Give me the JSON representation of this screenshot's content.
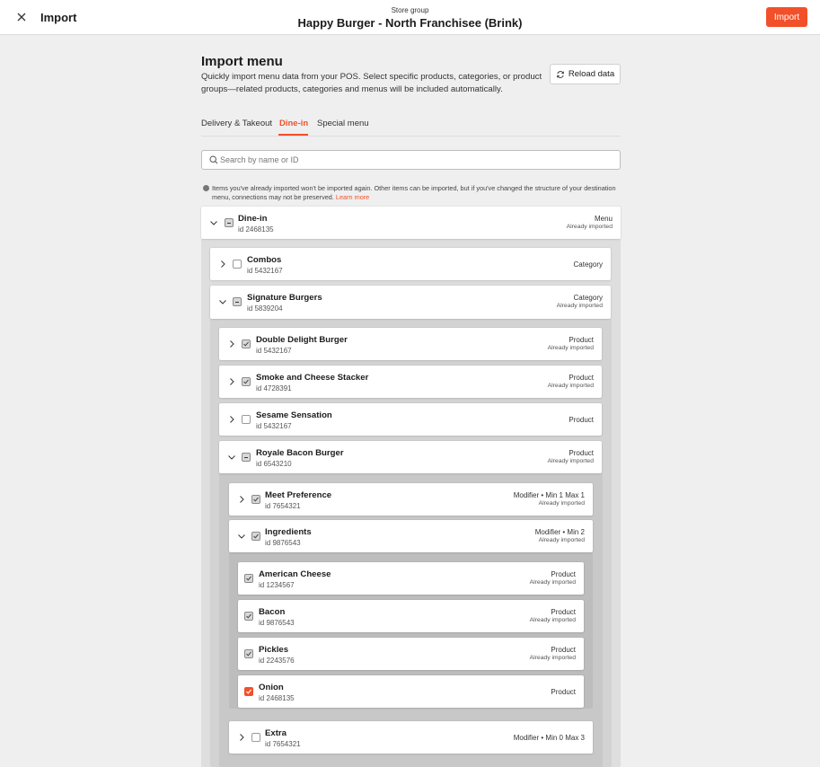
{
  "topbar": {
    "title": "Import",
    "store_group_label": "Store group",
    "store_group_name": "Happy Burger - North Franchisee (Brink)",
    "import_label": "Import"
  },
  "page": {
    "heading": "Import menu",
    "description": "Quickly import menu data from your POS. Select specific products, categories, or product groups—related products, categories and menus will be included automatically.",
    "reload_label": "Reload data"
  },
  "tabs": [
    {
      "label": "Delivery & Takeout",
      "active": false
    },
    {
      "label": "Dine-in",
      "active": true
    },
    {
      "label": "Special menu",
      "active": false
    }
  ],
  "search": {
    "placeholder": "Search by name or ID",
    "value": ""
  },
  "info": {
    "text": "Items you've already imported won't be imported again. Other items can be imported, but if you've changed the structure of your destination menu, connections may not be preserved.",
    "link": "Learn more"
  },
  "tree": [
    {
      "name": "Dine-in",
      "id": "id 2468135",
      "type": "Menu",
      "status": "Already imported",
      "expanded": true,
      "check": "mixed"
    },
    {
      "name": "Combos",
      "id": "id 5432167",
      "type": "Category",
      "status": "",
      "expanded": false,
      "check": "none"
    },
    {
      "name": "Signature Burgers",
      "id": "id 5839204",
      "type": "Category",
      "status": "Already imported",
      "expanded": true,
      "check": "mixed"
    },
    {
      "name": "Double Delight Burger",
      "id": "id 5432167",
      "type": "Product",
      "status": "Already imported",
      "expanded": false,
      "check": "checked"
    },
    {
      "name": "Smoke and Cheese Stacker",
      "id": "id 4728391",
      "type": "Product",
      "status": "Already imported",
      "expanded": false,
      "check": "checked"
    },
    {
      "name": "Sesame Sensation",
      "id": "id 5432167",
      "type": "Product",
      "status": "",
      "expanded": false,
      "check": "none"
    },
    {
      "name": "Royale Bacon Burger",
      "id": "id 6543210",
      "type": "Product",
      "status": "Already imported",
      "expanded": true,
      "check": "mixed"
    },
    {
      "name": "Meet Preference",
      "id": "id 7654321",
      "type": "Modifier • Min 1 Max 1",
      "status": "Already imported",
      "expanded": false,
      "check": "checked"
    },
    {
      "name": "Ingredients",
      "id": "id 9876543",
      "type": "Modifier • Min 2",
      "status": "Already imported",
      "expanded": true,
      "check": "checked"
    },
    {
      "name": "American Cheese",
      "id": "id 1234567",
      "type": "Product",
      "status": "Already imported",
      "check": "checked"
    },
    {
      "name": "Bacon",
      "id": "id 9876543",
      "type": "Product",
      "status": "Already imported",
      "check": "checked"
    },
    {
      "name": "Pickles",
      "id": "id 2243576",
      "type": "Product",
      "status": "Already imported",
      "check": "checked"
    },
    {
      "name": "Onion",
      "id": "id 2468135",
      "type": "Product",
      "status": "",
      "check": "on"
    },
    {
      "name": "Extra",
      "id": "id 7654321",
      "type": "Modifier • Min 0 Max 3",
      "status": "",
      "expanded": false,
      "check": "none"
    }
  ],
  "colors": {
    "accent": "#f2502a",
    "panel_l1": "#dedede",
    "panel_l2": "#d3d3d3",
    "panel_l3": "#c8c8c8",
    "panel_l4": "#bdbdbd"
  },
  "icons": {
    "close": "close-icon",
    "reload": "refresh-icon",
    "search": "search-icon",
    "info": "info-icon",
    "expand": "chevron-right-icon",
    "collapse": "chevron-down-icon"
  }
}
